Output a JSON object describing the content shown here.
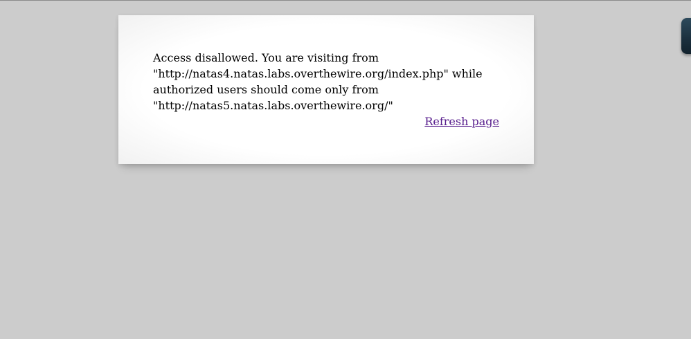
{
  "page": {
    "background_color": "#cccccc"
  },
  "message_card": {
    "lines": [
      "Access disallowed. You are visiting from",
      "\"http://natas4.natas.labs.overthewire.org/index.php\" while",
      "authorized users should come only from",
      "\"http://natas5.natas.labs.overthewire.org/\""
    ],
    "refresh_link_label": "Refresh page",
    "link_color": "#551a8b"
  },
  "side_widget": {
    "icon": "tab-widget-icon",
    "color": "#1b2f3d"
  }
}
